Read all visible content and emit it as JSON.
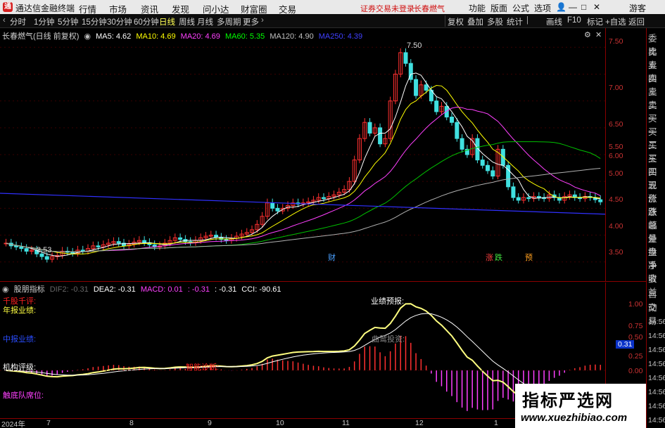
{
  "titlebar": {
    "logo": "通",
    "app_name": "通达信金融终端",
    "menu": [
      "行情",
      "市场",
      "资讯",
      "发现",
      "问小达",
      "财富圈",
      "交易"
    ],
    "notice": "证券交易未登录",
    "stock_tag": "长春燃气",
    "right_menu": [
      "功能",
      "版面",
      "公式",
      "选项"
    ],
    "user": "游客"
  },
  "toolbar": {
    "periods": [
      "分时",
      "1分钟",
      "5分钟",
      "15分钟",
      "30分钟",
      "60分钟",
      "日线",
      "周线",
      "月线",
      "多周期",
      "更多"
    ],
    "active_period": "日线",
    "right": [
      "复权",
      "叠加",
      "多股",
      "统计",
      "画线",
      "F10",
      "标记",
      "+自选",
      "返回"
    ]
  },
  "main_legend": {
    "stock": "长春燃气(日线 前复权)",
    "ma": [
      {
        "label": "MA5: 4.62",
        "color": "#ffffff"
      },
      {
        "label": "MA10: 4.69",
        "color": "#ffff00"
      },
      {
        "label": "MA20: 4.69",
        "color": "#ff40ff"
      },
      {
        "label": "MA60: 5.35",
        "color": "#00ff00"
      },
      {
        "label": "MA120: 4.90",
        "color": "#c0c0c0"
      },
      {
        "label": "MA250: 4.39",
        "color": "#4040ff"
      }
    ],
    "high_label": "7.50",
    "low_label": "3.53",
    "events": [
      "财",
      "涨",
      "跌",
      "预"
    ]
  },
  "main_axis": [
    "7.50",
    "7.00",
    "6.50",
    "6.00",
    "5.50",
    "5.00",
    "4.50",
    "4.00",
    "3.50"
  ],
  "sub_legend": {
    "name": "股朋指标",
    "items": [
      {
        "label": "DIF2: -0.31",
        "color": "#444444"
      },
      {
        "label": "DEA2: -0.31",
        "color": "#ffffff"
      },
      {
        "label": "MACD: 0.01",
        "color": "#ff40ff"
      },
      {
        "label": ": -0.31",
        "color": "#ff40ff"
      },
      {
        "label": ": -0.31",
        "color": "#ffffff"
      },
      {
        "label": "CCI: -90.61",
        "color": "#ffffff"
      }
    ],
    "annotations": [
      {
        "text": "千股千评:",
        "color": "#ff2020"
      },
      {
        "text": "年报业绩:",
        "color": "#ffff40"
      },
      {
        "text": "中报业绩:",
        "color": "#2a4dff"
      },
      {
        "text": "机构评级:",
        "color": "#ffffff"
      },
      {
        "text": "触底队席位:",
        "color": "#ff40ff"
      },
      {
        "text": "业绩预报:",
        "color": "#ffffff"
      },
      {
        "text": "智能诊断:",
        "color": "#ff2020"
      },
      {
        "text": "曲鹫投资:",
        "color": "#888888"
      }
    ]
  },
  "sub_axis": [
    "1.00",
    "0.75",
    "0.50",
    "0.25",
    "0.00"
  ],
  "sub_current": "0.31",
  "time_axis_right": [
    "14:56",
    "14:56",
    "14:56",
    "14:56",
    "14:56",
    "14:56",
    "14:56",
    "14:56"
  ],
  "dates": [
    "2024年",
    "7",
    "8",
    "9",
    "10",
    "11",
    "12",
    "1"
  ],
  "side_panel": [
    "委比",
    "卖五",
    "卖四",
    "卖三",
    "卖二",
    "卖一",
    "买一",
    "买二",
    "买三",
    "买四",
    "买五",
    "现价",
    "涨跌",
    "涨幅",
    "总量",
    "外盘",
    "换手",
    "净资",
    "收益",
    "自动",
    "交易"
  ],
  "watermark": {
    "title": "指标严选网",
    "url": "www.xuezhibiao.com"
  },
  "chart_data": {
    "type": "candlestick",
    "ylim": [
      3.3,
      7.7
    ],
    "closes": [
      3.85,
      3.8,
      3.78,
      3.75,
      3.7,
      3.72,
      3.65,
      3.6,
      3.55,
      3.6,
      3.62,
      3.7,
      3.68,
      3.66,
      3.72,
      3.7,
      3.75,
      3.8,
      3.78,
      3.82,
      3.85,
      3.88,
      3.85,
      3.8,
      3.83,
      3.87,
      3.9,
      3.86,
      3.82,
      3.78,
      3.8,
      3.85,
      3.9,
      3.95,
      3.92,
      3.88,
      3.86,
      3.9,
      3.95,
      3.98,
      4.0,
      3.96,
      3.92,
      3.9,
      3.94,
      3.98,
      4.02,
      4.05,
      4.1,
      4.2,
      4.35,
      4.6,
      4.5,
      4.45,
      4.5,
      4.55,
      4.6,
      4.58,
      4.6,
      4.62,
      4.65,
      4.7,
      4.68,
      4.72,
      4.75,
      4.8,
      4.85,
      5.0,
      5.4,
      5.8,
      6.1,
      5.9,
      6.0,
      5.7,
      5.8,
      6.5,
      7.0,
      7.4,
      7.2,
      6.9,
      6.6,
      6.8,
      6.7,
      6.5,
      6.3,
      6.4,
      6.2,
      6.1,
      5.8,
      5.6,
      5.5,
      5.8,
      5.4,
      5.3,
      5.2,
      5.1,
      5.6,
      5.3,
      4.9,
      4.7,
      4.65,
      4.7,
      4.68,
      4.72,
      4.7,
      4.68,
      4.75,
      4.7,
      4.65,
      4.72,
      4.75,
      4.7,
      4.68,
      4.72,
      4.7,
      4.66,
      4.62
    ]
  }
}
